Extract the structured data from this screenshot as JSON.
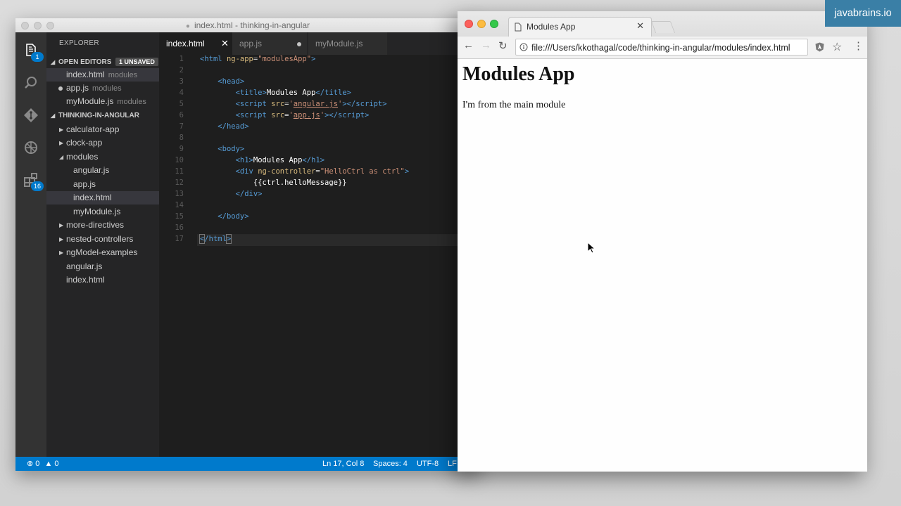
{
  "watermark": "javabrains.io",
  "vscode": {
    "window_title": "index.html - thinking-in-angular",
    "explorer_title": "EXPLORER",
    "activity_badges": {
      "explorer": "1",
      "extensions": "16"
    },
    "open_editors": {
      "label": "OPEN EDITORS",
      "badge": "1 UNSAVED",
      "items": [
        {
          "name": "index.html",
          "folder": "modules"
        },
        {
          "name": "app.js",
          "folder": "modules"
        },
        {
          "name": "myModule.js",
          "folder": "modules"
        }
      ]
    },
    "project": {
      "label": "THINKING-IN-ANGULAR",
      "items": [
        "calculator-app",
        "clock-app",
        "modules",
        "angular.js",
        "app.js",
        "index.html",
        "myModule.js",
        "more-directives",
        "nested-controllers",
        "ngModel-examples",
        "angular.js",
        "index.html"
      ]
    },
    "tabs": [
      {
        "label": "index.html",
        "active": true
      },
      {
        "label": "app.js",
        "modified": true
      },
      {
        "label": "myModule.js"
      }
    ],
    "line_numbers": [
      "1",
      "2",
      "3",
      "4",
      "5",
      "6",
      "7",
      "8",
      "9",
      "10",
      "11",
      "12",
      "13",
      "14",
      "15",
      "16",
      "17"
    ],
    "status": {
      "errors": "0",
      "warnings": "0",
      "cursor": "Ln 17, Col 8",
      "spaces": "Spaces: 4",
      "encoding": "UTF-8",
      "eol": "LF"
    }
  },
  "browser": {
    "tab_title": "Modules App",
    "url": "file:///Users/kkothagal/code/thinking-in-angular/modules/index.html",
    "page": {
      "heading": "Modules App",
      "paragraph": "I'm from the main module"
    }
  }
}
